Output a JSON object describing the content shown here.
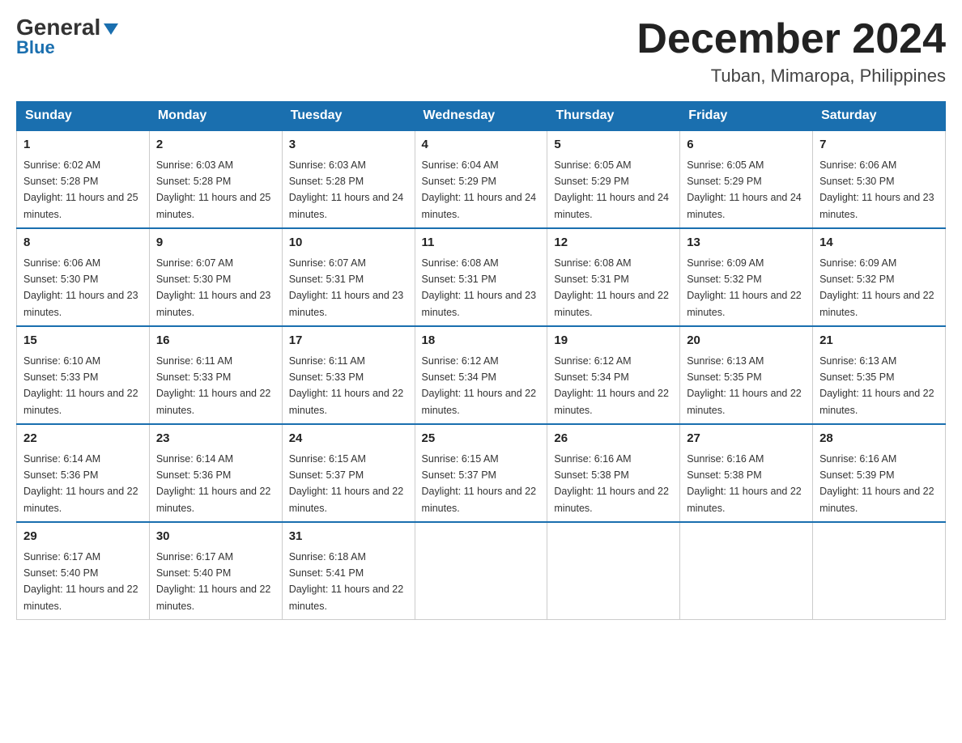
{
  "header": {
    "logo": {
      "general": "General",
      "blue": "Blue"
    },
    "title": "December 2024",
    "subtitle": "Tuban, Mimaropa, Philippines"
  },
  "calendar": {
    "headers": [
      "Sunday",
      "Monday",
      "Tuesday",
      "Wednesday",
      "Thursday",
      "Friday",
      "Saturday"
    ],
    "weeks": [
      [
        {
          "day": "1",
          "sunrise": "6:02 AM",
          "sunset": "5:28 PM",
          "daylight": "11 hours and 25 minutes."
        },
        {
          "day": "2",
          "sunrise": "6:03 AM",
          "sunset": "5:28 PM",
          "daylight": "11 hours and 25 minutes."
        },
        {
          "day": "3",
          "sunrise": "6:03 AM",
          "sunset": "5:28 PM",
          "daylight": "11 hours and 24 minutes."
        },
        {
          "day": "4",
          "sunrise": "6:04 AM",
          "sunset": "5:29 PM",
          "daylight": "11 hours and 24 minutes."
        },
        {
          "day": "5",
          "sunrise": "6:05 AM",
          "sunset": "5:29 PM",
          "daylight": "11 hours and 24 minutes."
        },
        {
          "day": "6",
          "sunrise": "6:05 AM",
          "sunset": "5:29 PM",
          "daylight": "11 hours and 24 minutes."
        },
        {
          "day": "7",
          "sunrise": "6:06 AM",
          "sunset": "5:30 PM",
          "daylight": "11 hours and 23 minutes."
        }
      ],
      [
        {
          "day": "8",
          "sunrise": "6:06 AM",
          "sunset": "5:30 PM",
          "daylight": "11 hours and 23 minutes."
        },
        {
          "day": "9",
          "sunrise": "6:07 AM",
          "sunset": "5:30 PM",
          "daylight": "11 hours and 23 minutes."
        },
        {
          "day": "10",
          "sunrise": "6:07 AM",
          "sunset": "5:31 PM",
          "daylight": "11 hours and 23 minutes."
        },
        {
          "day": "11",
          "sunrise": "6:08 AM",
          "sunset": "5:31 PM",
          "daylight": "11 hours and 23 minutes."
        },
        {
          "day": "12",
          "sunrise": "6:08 AM",
          "sunset": "5:31 PM",
          "daylight": "11 hours and 22 minutes."
        },
        {
          "day": "13",
          "sunrise": "6:09 AM",
          "sunset": "5:32 PM",
          "daylight": "11 hours and 22 minutes."
        },
        {
          "day": "14",
          "sunrise": "6:09 AM",
          "sunset": "5:32 PM",
          "daylight": "11 hours and 22 minutes."
        }
      ],
      [
        {
          "day": "15",
          "sunrise": "6:10 AM",
          "sunset": "5:33 PM",
          "daylight": "11 hours and 22 minutes."
        },
        {
          "day": "16",
          "sunrise": "6:11 AM",
          "sunset": "5:33 PM",
          "daylight": "11 hours and 22 minutes."
        },
        {
          "day": "17",
          "sunrise": "6:11 AM",
          "sunset": "5:33 PM",
          "daylight": "11 hours and 22 minutes."
        },
        {
          "day": "18",
          "sunrise": "6:12 AM",
          "sunset": "5:34 PM",
          "daylight": "11 hours and 22 minutes."
        },
        {
          "day": "19",
          "sunrise": "6:12 AM",
          "sunset": "5:34 PM",
          "daylight": "11 hours and 22 minutes."
        },
        {
          "day": "20",
          "sunrise": "6:13 AM",
          "sunset": "5:35 PM",
          "daylight": "11 hours and 22 minutes."
        },
        {
          "day": "21",
          "sunrise": "6:13 AM",
          "sunset": "5:35 PM",
          "daylight": "11 hours and 22 minutes."
        }
      ],
      [
        {
          "day": "22",
          "sunrise": "6:14 AM",
          "sunset": "5:36 PM",
          "daylight": "11 hours and 22 minutes."
        },
        {
          "day": "23",
          "sunrise": "6:14 AM",
          "sunset": "5:36 PM",
          "daylight": "11 hours and 22 minutes."
        },
        {
          "day": "24",
          "sunrise": "6:15 AM",
          "sunset": "5:37 PM",
          "daylight": "11 hours and 22 minutes."
        },
        {
          "day": "25",
          "sunrise": "6:15 AM",
          "sunset": "5:37 PM",
          "daylight": "11 hours and 22 minutes."
        },
        {
          "day": "26",
          "sunrise": "6:16 AM",
          "sunset": "5:38 PM",
          "daylight": "11 hours and 22 minutes."
        },
        {
          "day": "27",
          "sunrise": "6:16 AM",
          "sunset": "5:38 PM",
          "daylight": "11 hours and 22 minutes."
        },
        {
          "day": "28",
          "sunrise": "6:16 AM",
          "sunset": "5:39 PM",
          "daylight": "11 hours and 22 minutes."
        }
      ],
      [
        {
          "day": "29",
          "sunrise": "6:17 AM",
          "sunset": "5:40 PM",
          "daylight": "11 hours and 22 minutes."
        },
        {
          "day": "30",
          "sunrise": "6:17 AM",
          "sunset": "5:40 PM",
          "daylight": "11 hours and 22 minutes."
        },
        {
          "day": "31",
          "sunrise": "6:18 AM",
          "sunset": "5:41 PM",
          "daylight": "11 hours and 22 minutes."
        },
        null,
        null,
        null,
        null
      ]
    ]
  }
}
